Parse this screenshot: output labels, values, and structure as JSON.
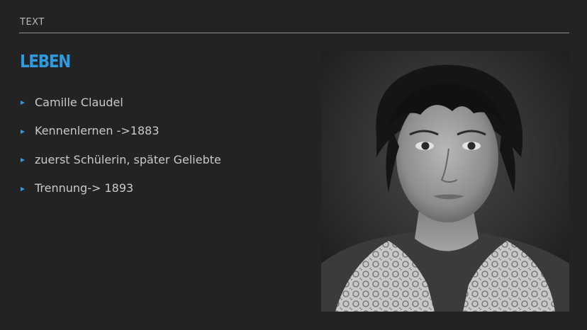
{
  "slide": {
    "section_label": "TEXT",
    "title": "LEBEN",
    "accent_color": "#2e9be0",
    "bullets": [
      {
        "text": "Camille Claudel"
      },
      {
        "text": "Kennenlernen ->1883"
      },
      {
        "text": "zuerst Schülerin, später Geliebte"
      },
      {
        "text": "Trennung-> 1893"
      }
    ],
    "photo": {
      "kind": "black-and-white portrait photograph"
    }
  }
}
